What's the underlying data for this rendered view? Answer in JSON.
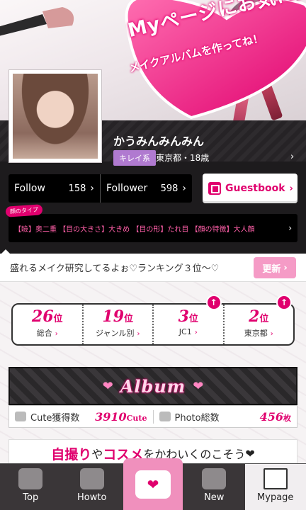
{
  "banner": {
    "title": "Myページにお気に入りの",
    "subtitle": "メイクアルバムを作ってね！"
  },
  "profile": {
    "username": "かうみんみんみん",
    "style_tag": "キレイ系",
    "location_age": "東京都・18歳",
    "follow_label": "Follow",
    "follow_count": "158",
    "follower_label": "Follower",
    "follower_count": "598",
    "guestbook_label": "Guestbook",
    "type_badge": "顔のタイプ",
    "type_text": "【瞼】奥二重 【目の大きさ】大きめ 【目の形】たれ目 【顔の特徴】大人顔"
  },
  "message": {
    "text": "盛れるメイク研究してるよぉ♡ランキング３位〜♡",
    "update_label": "更新"
  },
  "rankings": [
    {
      "rank": "26",
      "unit": "位",
      "label": "総合"
    },
    {
      "rank": "19",
      "unit": "位",
      "label": "ジャンル別"
    },
    {
      "rank": "3",
      "unit": "位",
      "label": "JC1"
    },
    {
      "rank": "2",
      "unit": "位",
      "label": "東京都"
    }
  ],
  "album": {
    "title": "Album",
    "cute_label": "Cute獲得数",
    "cute_value": "3910",
    "cute_unit": "Cute",
    "photo_label": "Photo総数",
    "photo_value": "456",
    "photo_unit": "枚"
  },
  "cta": {
    "part1": "自撮り",
    "part2": "や",
    "part3": "コスメ",
    "part4": "をかわいくのこそう",
    "heart": "❤"
  },
  "nav": {
    "top": "Top",
    "howto": "Howto",
    "new": "New",
    "mypage": "Mypage"
  },
  "colors": {
    "accent": "#e0006e",
    "pink_light": "#f090bd",
    "dark": "#1d1b1d"
  }
}
